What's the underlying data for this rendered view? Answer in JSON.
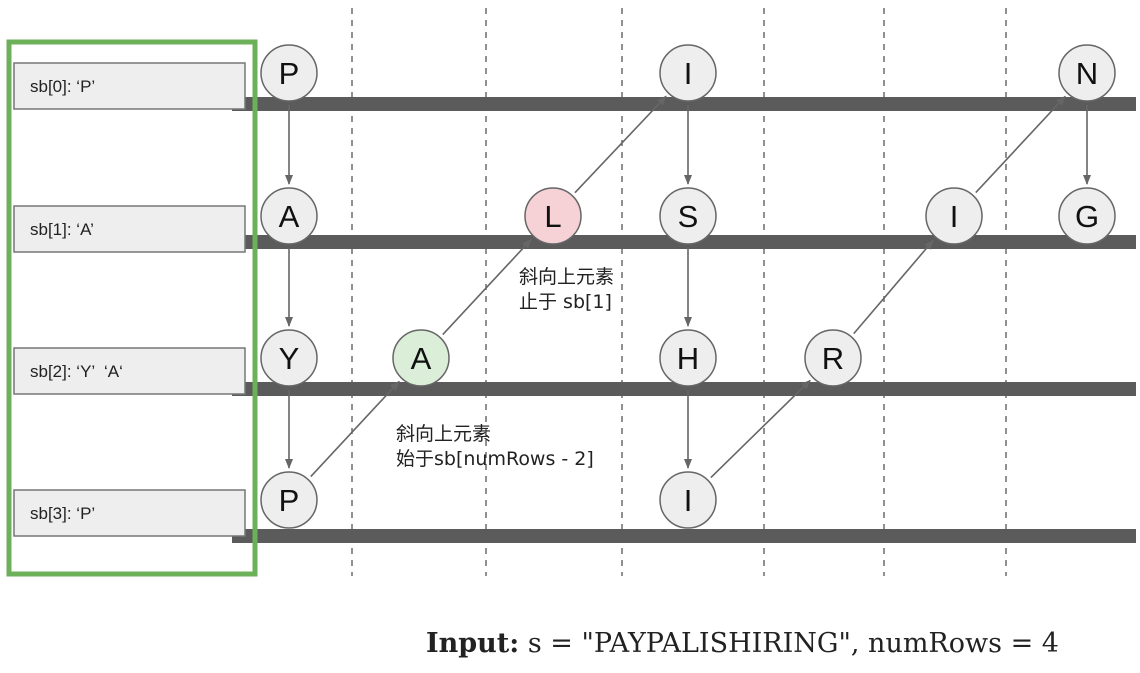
{
  "rows": [
    {
      "label": "sb[0]: ‘P’"
    },
    {
      "label": "sb[1]: ‘A’"
    },
    {
      "label": "sb[2]: ‘Y’  ‘A‘"
    },
    {
      "label": "sb[3]: ‘P’"
    }
  ],
  "nodes": [
    {
      "letter": "P",
      "row": 0,
      "col": 0,
      "fill": "#eeeeee"
    },
    {
      "letter": "A",
      "row": 1,
      "col": 0,
      "fill": "#eeeeee"
    },
    {
      "letter": "Y",
      "row": 2,
      "col": 0,
      "fill": "#eeeeee"
    },
    {
      "letter": "P",
      "row": 3,
      "col": 0,
      "fill": "#eeeeee"
    },
    {
      "letter": "A",
      "row": 2,
      "col": 1,
      "fill": "#dbeed8"
    },
    {
      "letter": "L",
      "row": 1,
      "col": 2,
      "fill": "#f6d2d6"
    },
    {
      "letter": "I",
      "row": 0,
      "col": 3,
      "fill": "#eeeeee"
    },
    {
      "letter": "S",
      "row": 1,
      "col": 3,
      "fill": "#eeeeee"
    },
    {
      "letter": "H",
      "row": 2,
      "col": 3,
      "fill": "#eeeeee"
    },
    {
      "letter": "I",
      "row": 3,
      "col": 3,
      "fill": "#eeeeee"
    },
    {
      "letter": "R",
      "row": 2,
      "col": 4,
      "fill": "#eeeeee"
    },
    {
      "letter": "I",
      "row": 1,
      "col": 5,
      "fill": "#eeeeee"
    },
    {
      "letter": "N",
      "row": 0,
      "col": 6,
      "fill": "#eeeeee"
    },
    {
      "letter": "G",
      "row": 1,
      "col": 6,
      "fill": "#eeeeee"
    }
  ],
  "edges": [
    {
      "from": 0,
      "to": 1
    },
    {
      "from": 1,
      "to": 2
    },
    {
      "from": 2,
      "to": 3
    },
    {
      "from": 3,
      "to": 4
    },
    {
      "from": 4,
      "to": 5
    },
    {
      "from": 5,
      "to": 6
    },
    {
      "from": 6,
      "to": 7
    },
    {
      "from": 7,
      "to": 8
    },
    {
      "from": 8,
      "to": 9
    },
    {
      "from": 9,
      "to": 10
    },
    {
      "from": 10,
      "to": 11
    },
    {
      "from": 11,
      "to": 12
    },
    {
      "from": 12,
      "to": 13
    }
  ],
  "annotations": [
    {
      "lines": [
        "斜向上元素",
        "止于 sb[1]"
      ]
    },
    {
      "lines": [
        "斜向上元素",
        "始于sb[numRows - 2]"
      ]
    }
  ],
  "input": {
    "label": "Input:",
    "text": "s = \"PAYPALISHIRING\", numRows = 4"
  },
  "colors": {
    "highlight_frame": "#6cb15a",
    "row_bar": "#5b5b5b",
    "arrow": "#666666",
    "node_stroke": "#666666",
    "grid": "#555555"
  }
}
